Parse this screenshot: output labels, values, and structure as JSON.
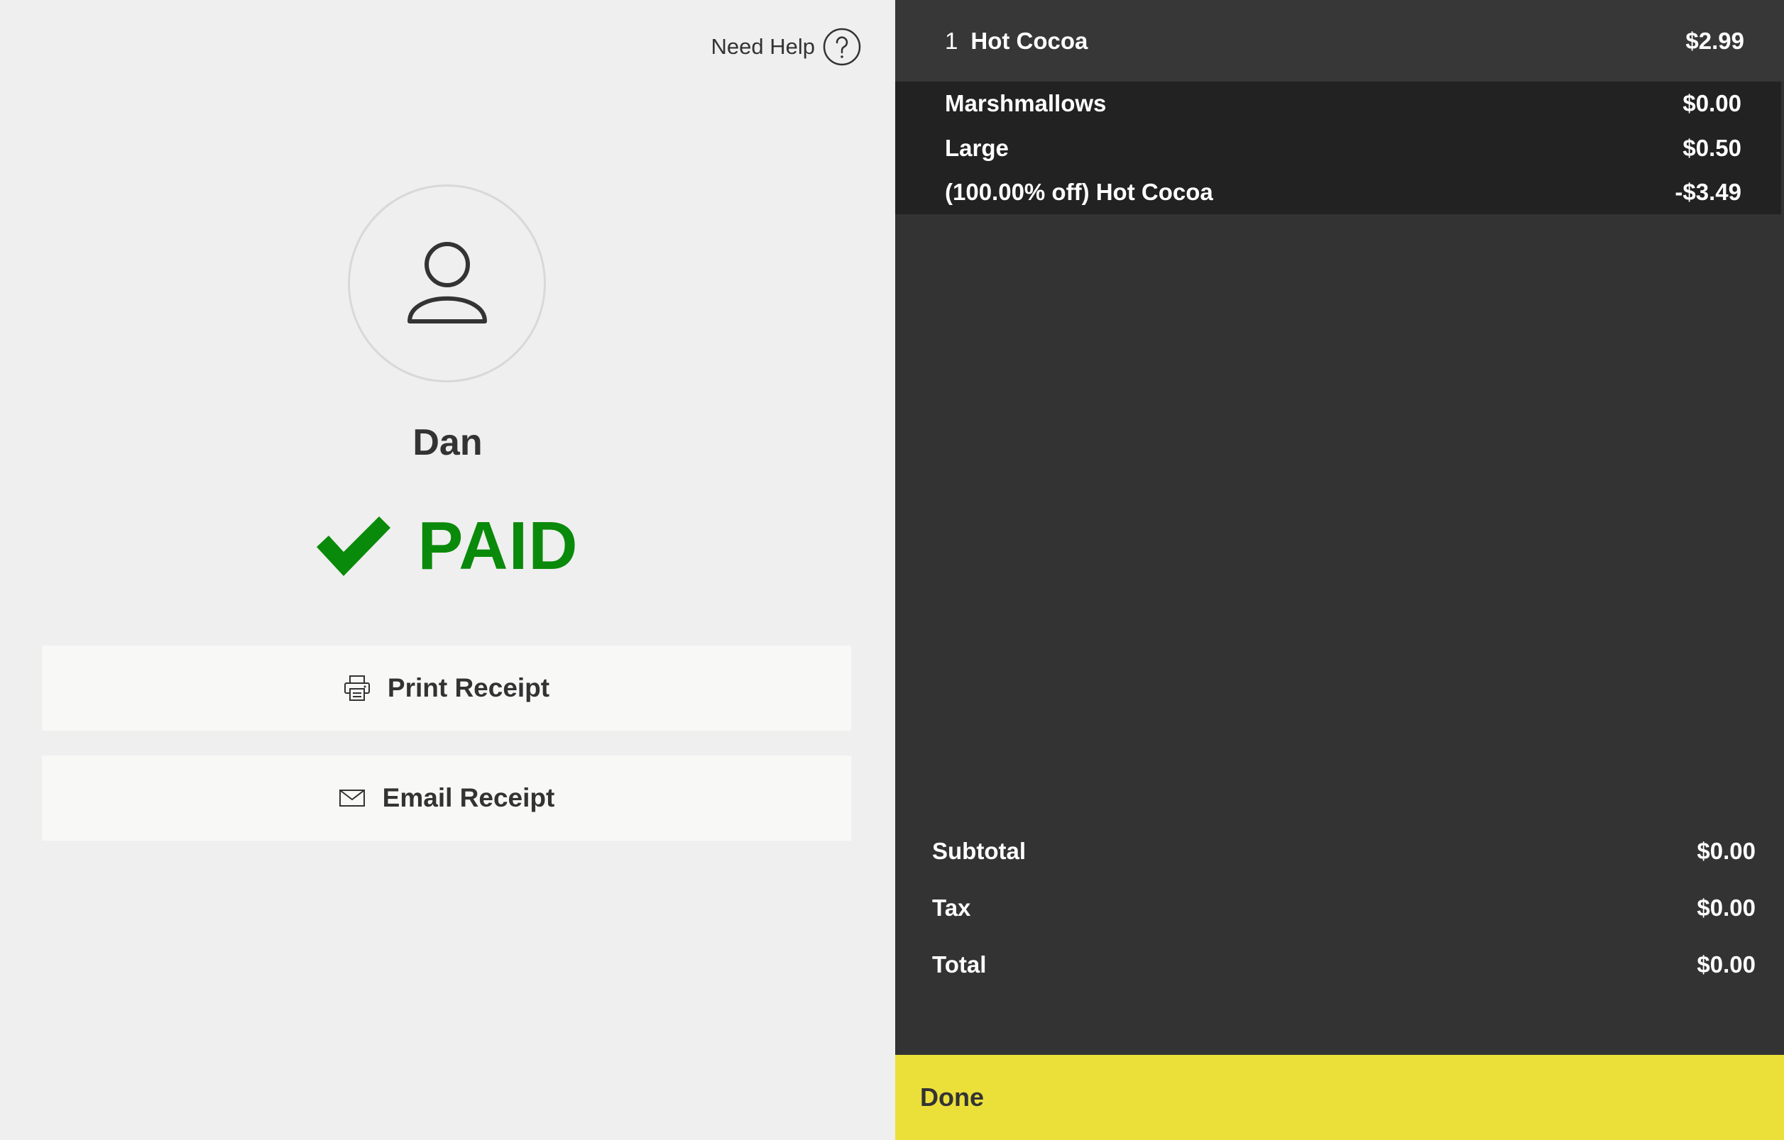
{
  "help": {
    "label": "Need Help",
    "icon": "question-icon"
  },
  "customer": {
    "name": "Dan",
    "icon": "user-icon"
  },
  "status": {
    "label": "PAID",
    "color": "#0a8a0a",
    "icon": "checkmark-icon"
  },
  "actions": {
    "print_label": "Print Receipt",
    "print_icon": "printer-icon",
    "email_label": "Email Receipt",
    "email_icon": "envelope-icon"
  },
  "order": {
    "qty": "1",
    "item": "Hot Cocoa",
    "price": "$2.99",
    "modifiers": [
      {
        "label": "Marshmallows",
        "price": "$0.00"
      },
      {
        "label": "Large",
        "price": "$0.50"
      },
      {
        "label": "(100.00% off) Hot Cocoa",
        "price": "-$3.49"
      }
    ]
  },
  "totals": {
    "subtotal_label": "Subtotal",
    "subtotal": "$0.00",
    "tax_label": "Tax",
    "tax": "$0.00",
    "total_label": "Total",
    "total": "$0.00"
  },
  "done": {
    "label": "Done",
    "color": "#ebe03a"
  }
}
